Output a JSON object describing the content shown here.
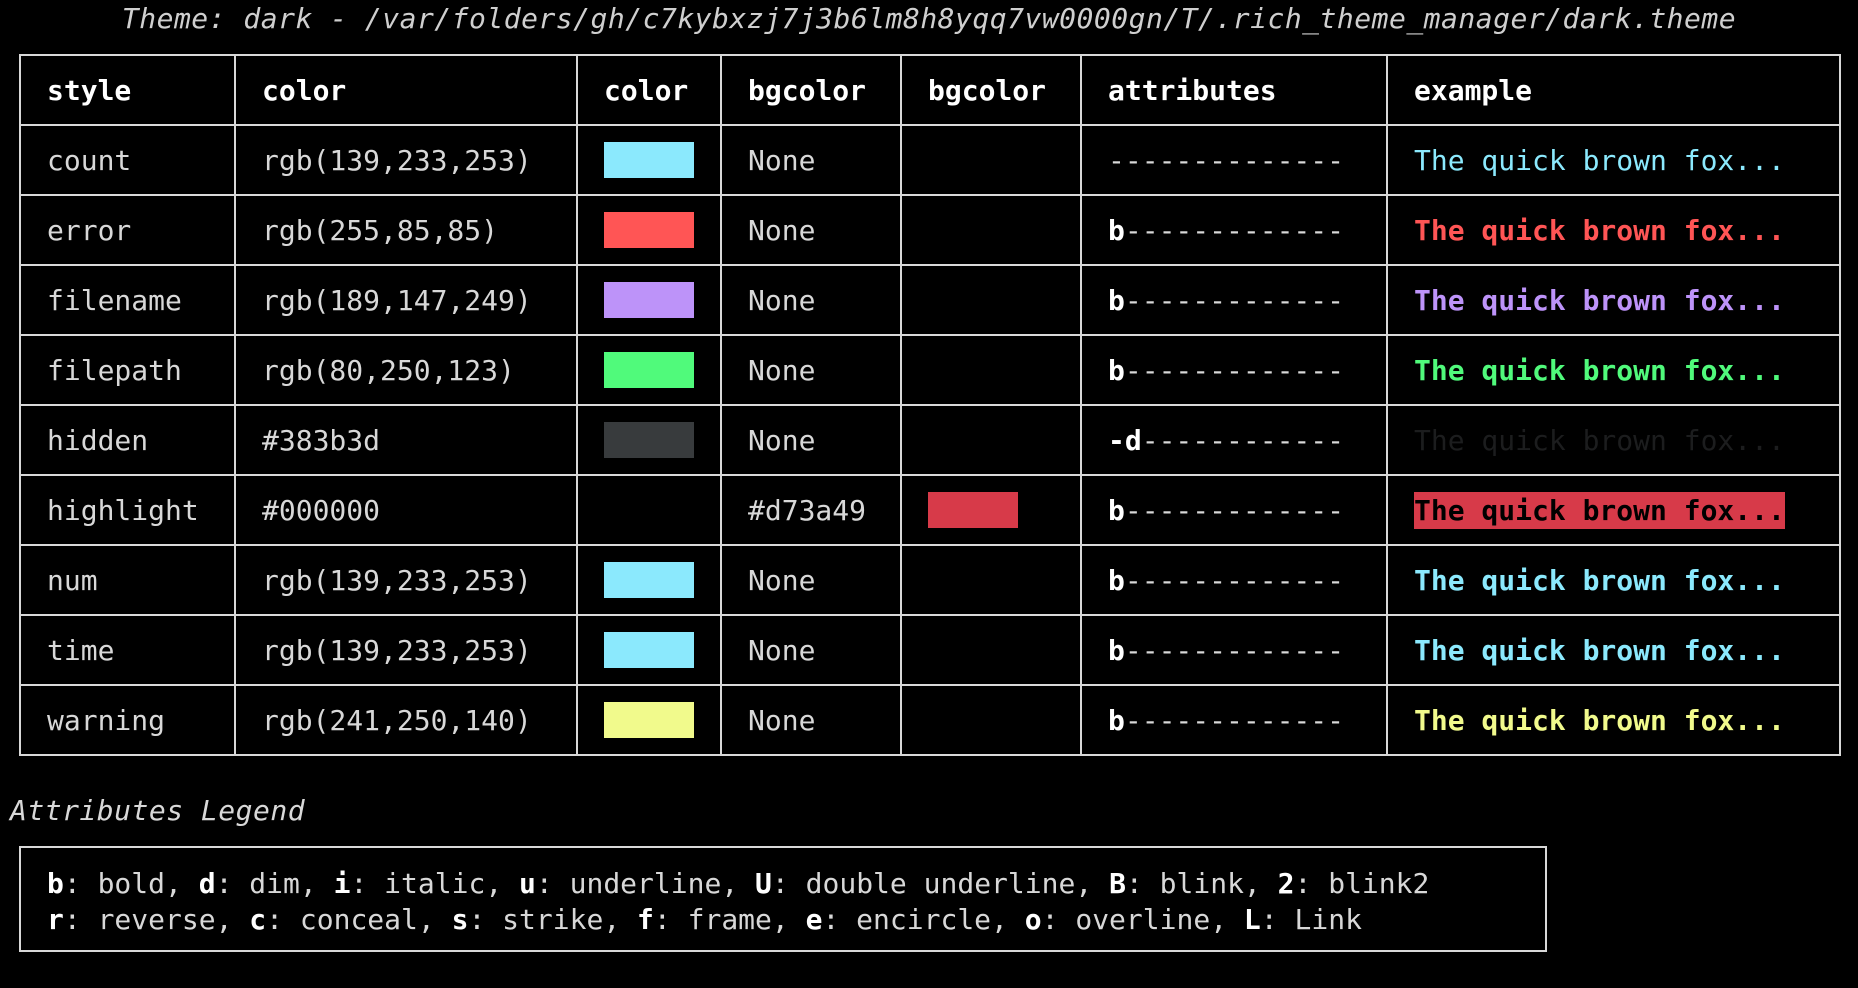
{
  "title": "Theme: dark - /var/folders/gh/c7kybxzj7j3b6lm8h8yqq7vw0000gn/T/.rich_theme_manager/dark.theme",
  "headers": [
    "style",
    "color",
    "color",
    "bgcolor",
    "bgcolor",
    "attributes",
    "example"
  ],
  "rows": [
    {
      "style": "count",
      "color": "rgb(139,233,253)",
      "color_hex": "#8be9fd",
      "bgcolor": "None",
      "bg_hex": "",
      "attr_bold": "",
      "attr_rest": "--------------",
      "example": "The quick brown fox...",
      "bold": false
    },
    {
      "style": "error",
      "color": "rgb(255,85,85)",
      "color_hex": "#ff5555",
      "bgcolor": "None",
      "bg_hex": "",
      "attr_bold": "b",
      "attr_rest": "-------------",
      "example": "The quick brown fox...",
      "bold": true
    },
    {
      "style": "filename",
      "color": "rgb(189,147,249)",
      "color_hex": "#bd93f9",
      "bgcolor": "None",
      "bg_hex": "",
      "attr_bold": "b",
      "attr_rest": "-------------",
      "example": "The quick brown fox...",
      "bold": true
    },
    {
      "style": "filepath",
      "color": "rgb(80,250,123)",
      "color_hex": "#50fa7b",
      "bgcolor": "None",
      "bg_hex": "",
      "attr_bold": "b",
      "attr_rest": "-------------",
      "example": "The quick brown fox...",
      "bold": true
    },
    {
      "style": "hidden",
      "color": "#383b3d",
      "color_hex": "#383b3d",
      "bgcolor": "None",
      "bg_hex": "",
      "attr_bold": "-d",
      "attr_rest": "------------",
      "example": "The quick brown fox...",
      "bold": false,
      "dim": true
    },
    {
      "style": "highlight",
      "color": "#000000",
      "color_hex": "#000000",
      "bgcolor": "#d73a49",
      "bg_hex": "#d73a49",
      "attr_bold": "b",
      "attr_rest": "-------------",
      "example": "The quick brown fox...",
      "bold": true
    },
    {
      "style": "num",
      "color": "rgb(139,233,253)",
      "color_hex": "#8be9fd",
      "bgcolor": "None",
      "bg_hex": "",
      "attr_bold": "b",
      "attr_rest": "-------------",
      "example": "The quick brown fox...",
      "bold": true
    },
    {
      "style": "time",
      "color": "rgb(139,233,253)",
      "color_hex": "#8be9fd",
      "bgcolor": "None",
      "bg_hex": "",
      "attr_bold": "b",
      "attr_rest": "-------------",
      "example": "The quick brown fox...",
      "bold": true
    },
    {
      "style": "warning",
      "color": "rgb(241,250,140)",
      "color_hex": "#f1fa8c",
      "bgcolor": "None",
      "bg_hex": "",
      "attr_bold": "b",
      "attr_rest": "-------------",
      "example": "The quick brown fox...",
      "bold": true
    }
  ],
  "legend": {
    "title": "Attributes Legend",
    "line1": [
      {
        "key": "b",
        "label": ": bold, "
      },
      {
        "key": "d",
        "label": ": dim, "
      },
      {
        "key": "i",
        "label": ": italic, "
      },
      {
        "key": "u",
        "label": ": underline, "
      },
      {
        "key": "U",
        "label": ": double underline, "
      },
      {
        "key": "B",
        "label": ": blink, "
      },
      {
        "key": "2",
        "label": ": blink2"
      }
    ],
    "line2": [
      {
        "key": "r",
        "label": ": reverse, "
      },
      {
        "key": "c",
        "label": ": conceal, "
      },
      {
        "key": "s",
        "label": ": strike, "
      },
      {
        "key": "f",
        "label": ": frame, "
      },
      {
        "key": "e",
        "label": ": encircle, "
      },
      {
        "key": "o",
        "label": ": overline, "
      },
      {
        "key": "L",
        "label": ": Link"
      }
    ]
  }
}
